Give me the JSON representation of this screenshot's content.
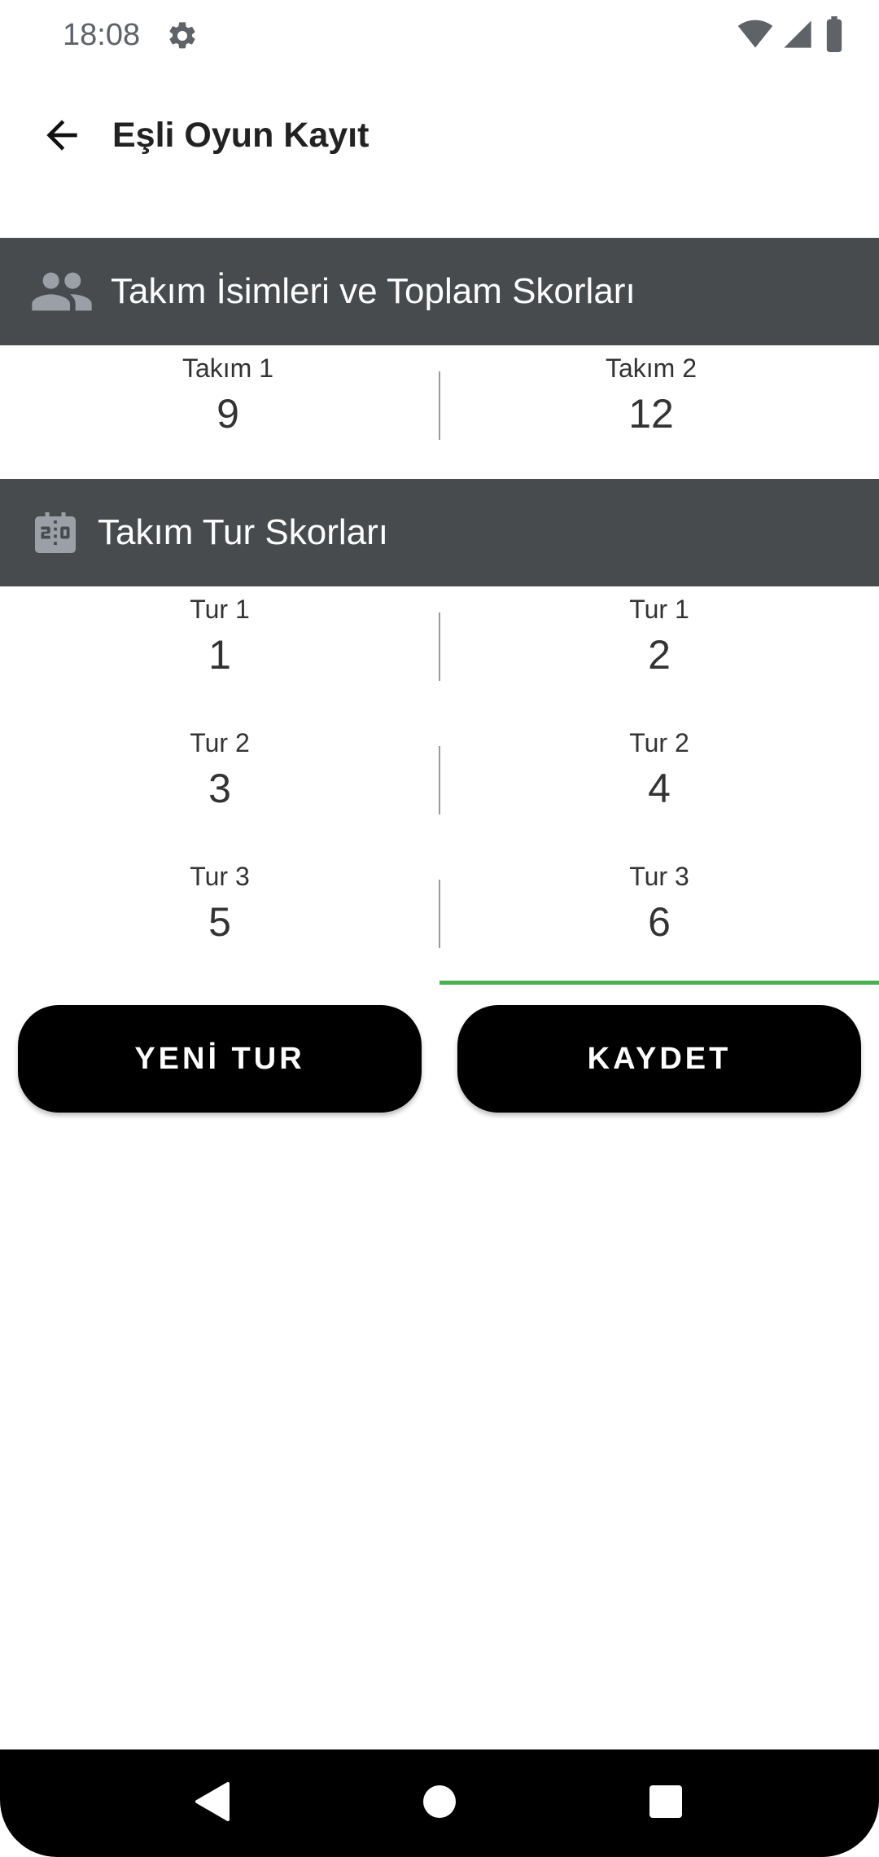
{
  "status_bar": {
    "time": "18:08",
    "icons": [
      "gear-icon",
      "wifi-icon",
      "signal-icon",
      "battery-icon"
    ]
  },
  "app_bar": {
    "title": "Eşli Oyun Kayıt",
    "back_icon": "arrow-back-icon"
  },
  "teams_section": {
    "icon": "people-icon",
    "title": "Takım İsimleri ve Toplam Skorları",
    "teams": [
      {
        "name": "Takım 1",
        "total": "9"
      },
      {
        "name": "Takım 2",
        "total": "12"
      }
    ]
  },
  "rounds_section": {
    "icon": "scoreboard-icon",
    "title": "Takım Tur Skorları",
    "rows": [
      {
        "left_label": "Tur 1",
        "left_score": "1",
        "right_label": "Tur 1",
        "right_score": "2"
      },
      {
        "left_label": "Tur 2",
        "left_score": "3",
        "right_label": "Tur 2",
        "right_score": "4"
      },
      {
        "left_label": "Tur 3",
        "left_score": "5",
        "right_label": "Tur 3",
        "right_score": "6"
      }
    ]
  },
  "buttons": {
    "new_round": "YENİ TUR",
    "save": "KAYDET"
  },
  "colors": {
    "section_header_bg": "#474b4e",
    "focus_underline": "#4caf50",
    "button_bg": "#000000",
    "button_text": "#ffffff"
  },
  "nav_bar": {
    "icons": [
      "nav-back-icon",
      "nav-home-icon",
      "nav-recents-icon"
    ]
  }
}
